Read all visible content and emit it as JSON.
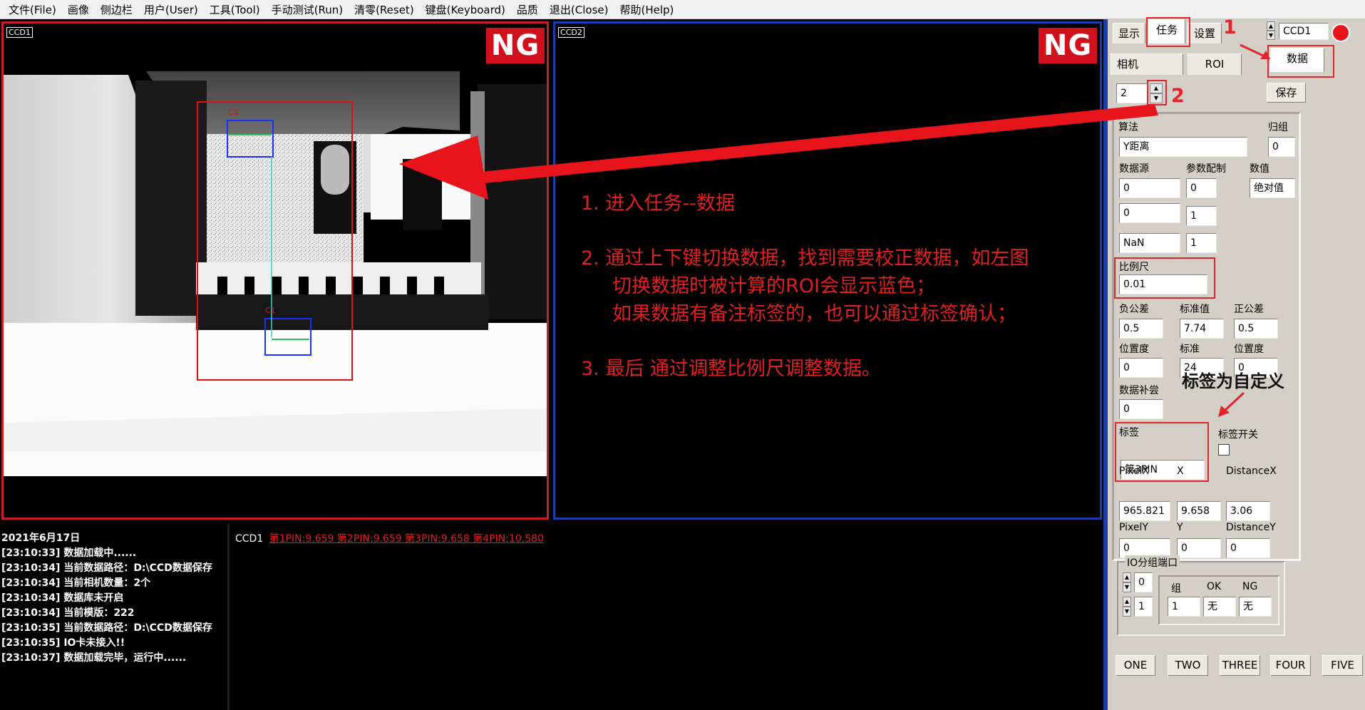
{
  "menu": [
    "文件(File)",
    "画像",
    "侧边栏",
    "用户(User)",
    "工具(Tool)",
    "手动测试(Run)",
    "清零(Reset)",
    "键盘(Keyboard)",
    "品质",
    "退出(Close)",
    "帮助(Help)"
  ],
  "ccd1": {
    "tag": "CCD1",
    "status": "NG",
    "roi_labels": [
      "C0",
      "C1"
    ]
  },
  "ccd2": {
    "tag": "CCD2",
    "status": "NG"
  },
  "annotations": {
    "step1": "1. 进入任务--数据",
    "step2": "2. 通过上下键切换数据，找到需要校正数据，如左图",
    "step2_line2": "切换数据时被计算的ROI会显示蓝色；",
    "step2_line3": "如果数据有备注标签的，也可以通过标签确认；",
    "step3": "3. 最后 通过调整比例尺调整数据。",
    "marker1": "1",
    "marker2": "2",
    "tag_note": "标签为自定义"
  },
  "log": {
    "date": "2021年6月17日",
    "lines": [
      "[23:10:33]  数据加载中......",
      "[23:10:34]  当前数据路径：D:\\CCD数据保存",
      "[23:10:34]  当前相机数量：2个",
      "[23:10:34]  数据库未开启",
      "[23:10:34]  当前模版：222",
      "[23:10:35]  当前数据路径：D:\\CCD数据保存",
      "[23:10:35]  IO卡未接入!!",
      "[23:10:37]  数据加载完毕，运行中......"
    ],
    "result_prefix": "CCD1",
    "result_text": "第1PIN:9.659  第2PIN:9.659  第3PIN:9.658  第4PIN:10.580 "
  },
  "panel": {
    "tabs": [
      "显示",
      "任务",
      "设置"
    ],
    "ccd_select": "CCD1",
    "status_color": "#e8141c",
    "subtabs": [
      "相机",
      "ROI",
      "数据"
    ],
    "index_value": "2",
    "save_label": "保存",
    "algo_label": "算法",
    "algo_value": "Y距离",
    "group_label": "归组",
    "group_value": "0",
    "source_label": "数据源",
    "param_label": "参数配制",
    "value_label": "数值",
    "source1": "0",
    "param1": "0",
    "value_mode": "绝对值",
    "source2": "0",
    "param2": "1",
    "source3": "NaN",
    "param3": "1",
    "scale_label": "比例尺",
    "scale_value": "0.01",
    "neg_tol_label": "负公差",
    "std_val_label": "标准值",
    "pos_tol_label": "正公差",
    "neg_tol": "0.5",
    "std_val": "7.74",
    "pos_tol": "0.5",
    "pos_label": "位置度",
    "std_label": "标准",
    "pos2_label": "位置度",
    "pos_val": "0",
    "std_val2": "24",
    "pos2_val": "0",
    "comp_label": "数据补尝",
    "comp_value": "0",
    "tag_label": "标签",
    "tag_value": "第3PIN",
    "tag_switch_label": "标签开关",
    "pixelx_label": "PixelX",
    "x_label": "X",
    "distx_label": "DistanceX",
    "pixelx": "965.821",
    "x": "9.658",
    "distx": "3.06",
    "pixely_label": "PixelY",
    "y_label": "Y",
    "disty_label": "DistanceY",
    "pixely": "0",
    "y": "0",
    "disty": "0",
    "io_title": "IO分组端口",
    "io_spin1": "0",
    "io_spin2": "1",
    "io_group_label": "组",
    "io_ok_label": "OK",
    "io_ng_label": "NG",
    "io_group": "1",
    "io_ok": "无",
    "io_ng": "无",
    "bottom_buttons": [
      "ONE",
      "TWO",
      "THREE",
      "FOUR",
      "FIVE"
    ]
  }
}
